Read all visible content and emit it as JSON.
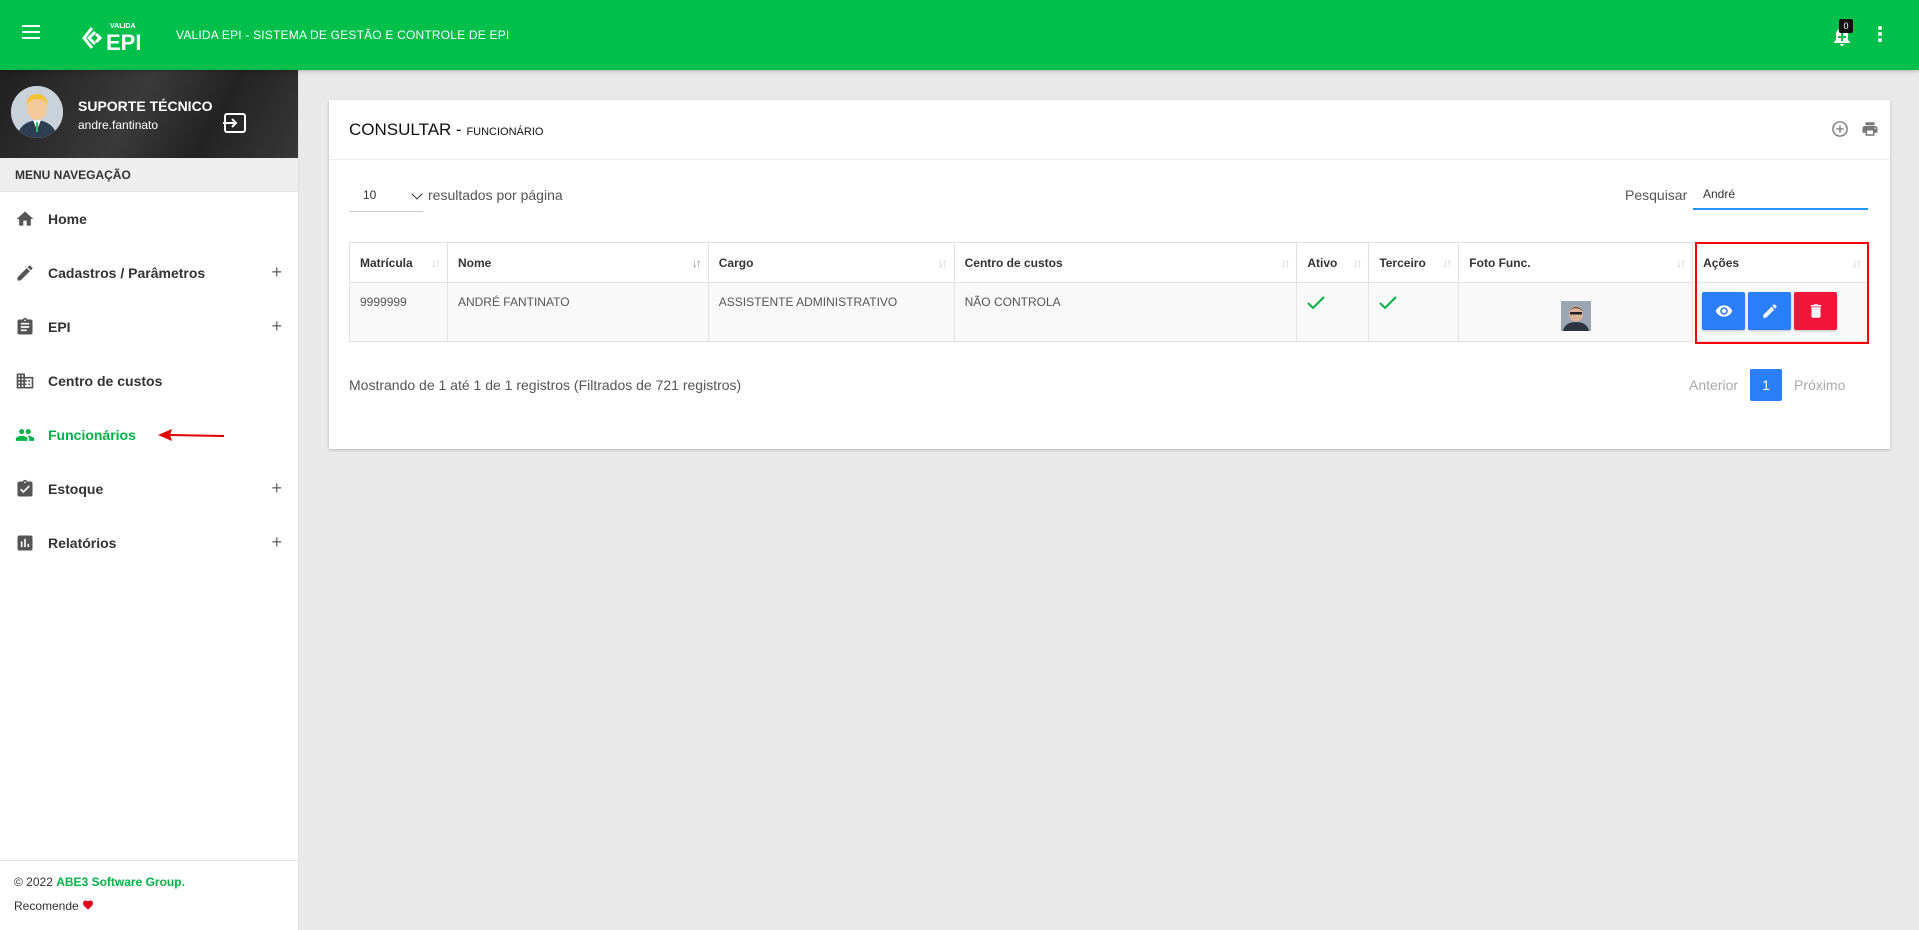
{
  "topbar": {
    "title": "VALIDA EPI - SISTEMA DE GESTÃO E CONTROLE DE EPI",
    "logo_small": "VALIDA",
    "logo_big": "EPI",
    "notifications": "0",
    "color": "#00c04b"
  },
  "user": {
    "name": "SUPORTE TÉCNICO",
    "login": "andre.fantinato"
  },
  "sidebar": {
    "header": "MENU NAVEGAÇÃO",
    "items": [
      {
        "label": "Home",
        "icon": "home-icon"
      },
      {
        "label": "Cadastros / Parâmetros",
        "icon": "pencil-icon",
        "expand": "+"
      },
      {
        "label": "EPI",
        "icon": "clipboard-icon",
        "expand": "+"
      },
      {
        "label": "Centro de custos",
        "icon": "building-icon"
      },
      {
        "label": "Funcionários",
        "icon": "people-icon",
        "active": true
      },
      {
        "label": "Estoque",
        "icon": "clipboard-check-icon",
        "expand": "+"
      },
      {
        "label": "Relatórios",
        "icon": "bar-chart-icon",
        "expand": "+"
      }
    ],
    "footer_copy": "© 2022 ",
    "footer_brand": "ABE3 Software Group.",
    "footer_recommend": "Recomende "
  },
  "card": {
    "title": "CONSULTAR - ",
    "subtitle": "FUNCIONÁRIO",
    "page_length": "10",
    "page_length_label": "resultados por página",
    "search_label": "Pesquisar",
    "search_value": "André",
    "columns": [
      "Matrícula",
      "Nome",
      "Cargo",
      "Centro de custos",
      "Ativo",
      "Terceiro",
      "Foto Func.",
      "Ações"
    ],
    "rows": [
      {
        "matricula": "9999999",
        "nome": "ANDRÉ FANTINATO",
        "cargo": "ASSISTENTE ADMINISTRATIVO",
        "centro": "NÃO CONTROLA",
        "ativo": true,
        "terceiro": true
      }
    ],
    "info": "Mostrando de 1 até 1 de 1 registros (Filtrados de 721 registros)",
    "prev": "Anterior",
    "page": "1",
    "next": "Próximo"
  },
  "colors": {
    "accent_green": "#00b347",
    "button_blue": "#2a7ef7",
    "button_red": "#f0163a",
    "highlight_red": "#ff0000"
  }
}
